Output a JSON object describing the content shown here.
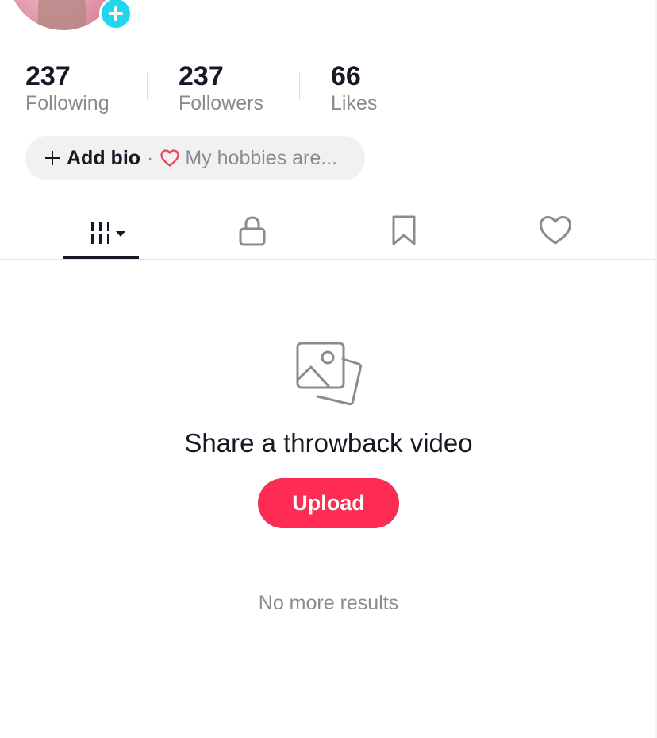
{
  "profile": {
    "avatar_icon": "profile-photo",
    "add_icon": "plus-icon"
  },
  "stats": [
    {
      "value": "237",
      "label": "Following"
    },
    {
      "value": "237",
      "label": "Followers"
    },
    {
      "value": "66",
      "label": "Likes"
    }
  ],
  "bio": {
    "add_label": "Add bio",
    "separator": "·",
    "prompt": "My hobbies are..."
  },
  "tabs": [
    {
      "icon": "grid-icon",
      "active": true
    },
    {
      "icon": "lock-icon",
      "active": false
    },
    {
      "icon": "bookmark-icon",
      "active": false
    },
    {
      "icon": "heart-icon",
      "active": false
    }
  ],
  "empty_state": {
    "icon": "photos-icon",
    "title": "Share a throwback video",
    "button_label": "Upload"
  },
  "footer": {
    "no_more": "No more results"
  },
  "colors": {
    "accent": "#fe2c55",
    "add_badge": "#20d5ec",
    "text_primary": "#161823",
    "text_secondary": "#8a8b91",
    "pill_bg": "#f1f1f2"
  }
}
